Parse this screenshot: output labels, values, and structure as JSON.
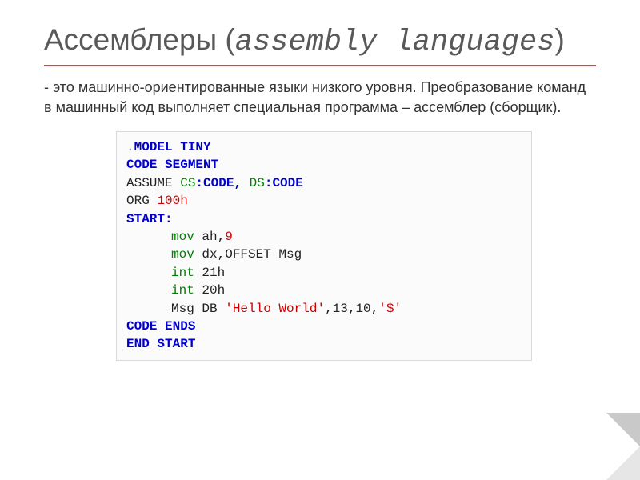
{
  "title": {
    "main": "Ассемблеры",
    "paren_open": " (",
    "sub": "assembly languages",
    "paren_close": ")"
  },
  "description": "- это машинно-ориентированные языки низкого уровня. Преобразование команд в машинный код выполняет специальная программа – ассемблер (сборщик).",
  "code": {
    "l1_dot": ".",
    "l1_model": "MODEL TINY",
    "l2": "CODE SEGMENT",
    "l3_assume": "ASSUME ",
    "l3_cs": "CS",
    "l3_colon1": ":",
    "l3_code1": "CODE",
    "l3_comma": ", ",
    "l3_ds": "DS",
    "l3_colon2": ":",
    "l3_code2": "CODE",
    "l4_org": "ORG ",
    "l4_addr": "100h",
    "l5_start": "START",
    "l5_colon": ":",
    "l6_mov": "mov",
    "l6_rest": " ah,",
    "l6_num": "9",
    "l7_mov": "mov",
    "l7_rest": " dx,OFFSET Msg",
    "l8_int": "int",
    "l8_num": " 21h",
    "l9_int": "int",
    "l9_num": " 20h",
    "l10_msg": "Msg DB ",
    "l10_str": "'Hello World'",
    "l10_rest": ",13,10,",
    "l10_dollar": "'$'",
    "l11": "CODE ENDS",
    "l12_end": "END ",
    "l12_start": "START"
  }
}
